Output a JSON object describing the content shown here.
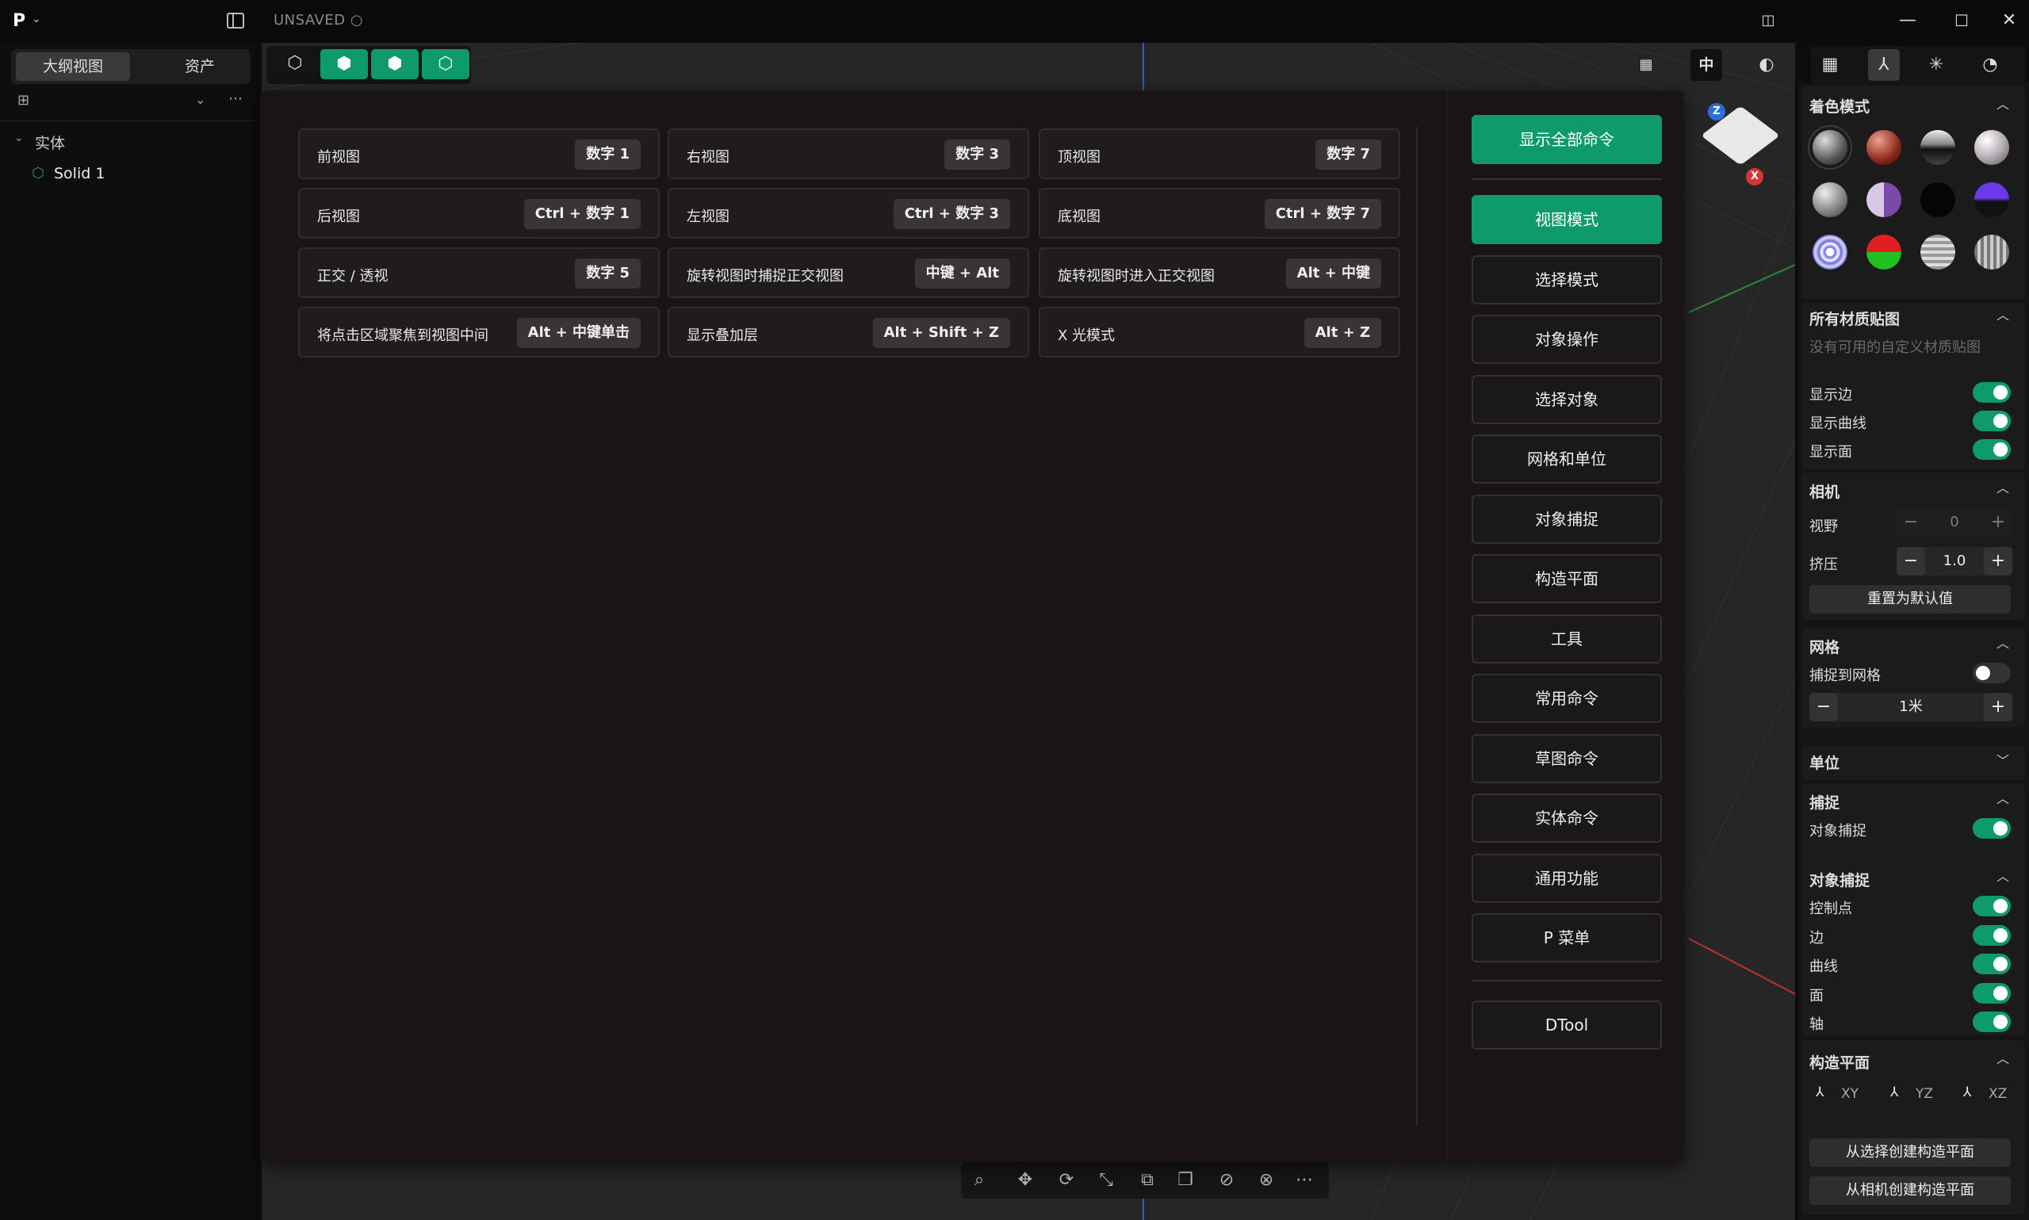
{
  "titlebar": {
    "logo": "P",
    "status": "UNSAVED ○",
    "minimize": "—",
    "maximize": "☐",
    "close": "✕"
  },
  "left_panel": {
    "tabs": [
      "大纲视图",
      "资产"
    ],
    "tree": {
      "group_label": "实体",
      "items": [
        "Solid 1"
      ]
    }
  },
  "viewport": {
    "top_right_tools": [
      "中"
    ]
  },
  "shortcuts": [
    {
      "label": "前视图",
      "key": "数字 1"
    },
    {
      "label": "右视图",
      "key": "数字 3"
    },
    {
      "label": "顶视图",
      "key": "数字 7"
    },
    {
      "label": "后视图",
      "key": "Ctrl + 数字 1"
    },
    {
      "label": "左视图",
      "key": "Ctrl + 数字 3"
    },
    {
      "label": "底视图",
      "key": "Ctrl + 数字 7"
    },
    {
      "label": "正交 / 透视",
      "key": "数字 5"
    },
    {
      "label": "旋转视图时捕捉正交视图",
      "key": "中键 + Alt"
    },
    {
      "label": "旋转视图时进入正交视图",
      "key": "Alt + 中键"
    },
    {
      "label": "将点击区域聚焦到视图中间",
      "key": "Alt + 中键单击"
    },
    {
      "label": "显示叠加层",
      "key": "Alt + Shift + Z"
    },
    {
      "label": "X 光模式",
      "key": "Alt + Z"
    }
  ],
  "categories": {
    "show_all": "显示全部命令",
    "items": [
      "视图模式",
      "选择模式",
      "对象操作",
      "选择对象",
      "网格和单位",
      "对象捕捉",
      "构造平面",
      "工具",
      "常用命令",
      "草图命令",
      "实体命令",
      "通用功能",
      "P 菜单"
    ],
    "extra": "DTool"
  },
  "right_panel": {
    "shading": {
      "title": "着色模式"
    },
    "materials": {
      "title": "所有材质贴图",
      "empty": "没有可用的自定义材质贴图"
    },
    "display": {
      "show_edges": "显示边",
      "show_curves": "显示曲线",
      "show_faces": "显示面"
    },
    "camera": {
      "title": "相机",
      "fov_label": "视野",
      "fov_value": "0",
      "squeeze_label": "挤压",
      "squeeze_value": "1.0",
      "reset": "重置为默认值"
    },
    "grid": {
      "title": "网格",
      "snap_to_grid": "捕捉到网格",
      "size_value": "1米"
    },
    "units": {
      "title": "单位"
    },
    "snap": {
      "title": "捕捉",
      "object_snap": "对象捕捉"
    },
    "object_snap": {
      "title": "对象捕捉",
      "items": [
        "控制点",
        "边",
        "曲线",
        "面",
        "轴"
      ]
    },
    "cplane": {
      "title": "构造平面",
      "options": [
        "XY",
        "YZ",
        "XZ"
      ],
      "from_selection": "从选择创建构造平面",
      "from_camera": "从相机创建构造平面"
    }
  },
  "colors": {
    "accent": "#0f9a6c",
    "popup_bg": "#181514"
  }
}
